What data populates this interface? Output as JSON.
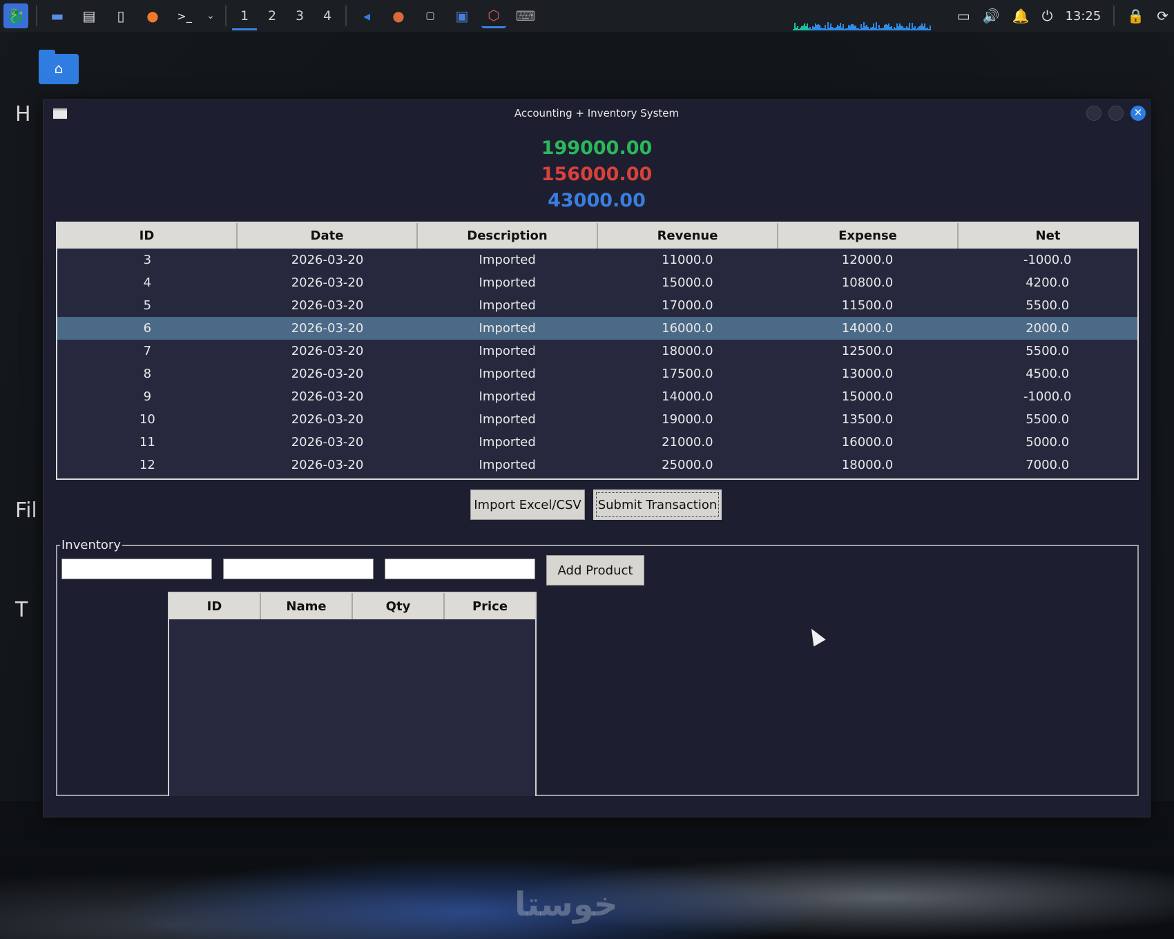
{
  "taskbar": {
    "workspaces": [
      "1",
      "2",
      "3",
      "4"
    ],
    "active_workspace": "1",
    "clock": "13:25",
    "launcher_icons": [
      "kali-menu-icon",
      "desktop-icon",
      "file-manager-icon",
      "text-editor-icon",
      "firefox-icon",
      "terminal-icon"
    ],
    "tray_icons": [
      "display-icon",
      "volume-icon",
      "notification-bell-icon",
      "power-icon",
      "lock-icon",
      "logout-icon"
    ]
  },
  "desktop": {
    "edge_texts": [
      "H",
      "Fil",
      "T"
    ]
  },
  "window": {
    "title": "Accounting + Inventory System",
    "totals": {
      "revenue": "199000.00",
      "expense": "156000.00",
      "net": "43000.00"
    },
    "colors": {
      "revenue": "#2ab85a",
      "expense": "#d8423a",
      "net": "#3a7ee0",
      "selected_row": "#4b6a87",
      "window_bg": "#1d1f30",
      "table_bg": "#26283e"
    },
    "transactions": {
      "columns": [
        "ID",
        "Date",
        "Description",
        "Revenue",
        "Expense",
        "Net"
      ],
      "selected_id": "6",
      "rows": [
        [
          "3",
          "2026-03-20",
          "Imported",
          "11000.0",
          "12000.0",
          "-1000.0"
        ],
        [
          "4",
          "2026-03-20",
          "Imported",
          "15000.0",
          "10800.0",
          "4200.0"
        ],
        [
          "5",
          "2026-03-20",
          "Imported",
          "17000.0",
          "11500.0",
          "5500.0"
        ],
        [
          "6",
          "2026-03-20",
          "Imported",
          "16000.0",
          "14000.0",
          "2000.0"
        ],
        [
          "7",
          "2026-03-20",
          "Imported",
          "18000.0",
          "12500.0",
          "5500.0"
        ],
        [
          "8",
          "2026-03-20",
          "Imported",
          "17500.0",
          "13000.0",
          "4500.0"
        ],
        [
          "9",
          "2026-03-20",
          "Imported",
          "14000.0",
          "15000.0",
          "-1000.0"
        ],
        [
          "10",
          "2026-03-20",
          "Imported",
          "19000.0",
          "13500.0",
          "5500.0"
        ],
        [
          "11",
          "2026-03-20",
          "Imported",
          "21000.0",
          "16000.0",
          "5000.0"
        ],
        [
          "12",
          "2026-03-20",
          "Imported",
          "25000.0",
          "18000.0",
          "7000.0"
        ]
      ]
    },
    "buttons": {
      "import": "Import Excel/CSV",
      "submit": "Submit Transaction"
    },
    "inventory": {
      "legend": "Inventory",
      "inputs": [
        "",
        "",
        ""
      ],
      "add_button": "Add Product",
      "columns": [
        "ID",
        "Name",
        "Qty",
        "Price"
      ],
      "rows": []
    }
  }
}
